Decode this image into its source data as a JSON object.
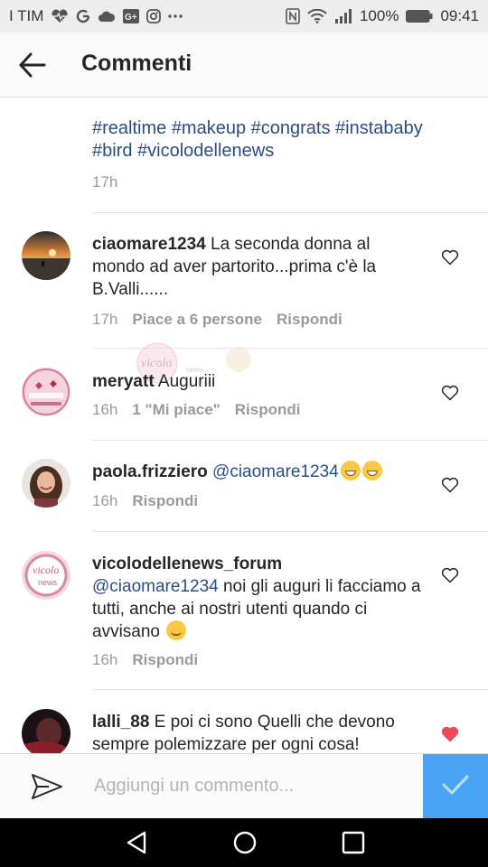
{
  "status_bar": {
    "carrier": "I TIM",
    "battery": "100%",
    "time": "09:41"
  },
  "header": {
    "title": "Commenti"
  },
  "caption": {
    "text": "#realtime #makeup #congrats #instababy #bird #vicolodellenews",
    "time": "17h"
  },
  "comments": [
    {
      "username": "ciaomare1234",
      "text": "La seconda donna al mondo ad aver partorito...prima c'è la B.Valli......",
      "time": "17h",
      "likes": "Piace a 6 persone",
      "reply": "Rispondi",
      "liked": false
    },
    {
      "username": "meryatt",
      "text": "Auguriii",
      "time": "16h",
      "likes": "1 \"Mi piace\"",
      "reply": "Rispondi",
      "liked": false
    },
    {
      "username": "paola.frizziero",
      "mention": "@ciaomare1234",
      "emoji": "grinning-face-with-smiling-eyes x2",
      "time": "16h",
      "reply": "Rispondi",
      "liked": false
    },
    {
      "username": "vicolodellenews_forum",
      "mention": "@ciaomare1234",
      "text": "noi gli auguri li facciamo a tutti, anche ai nostri utenti quando ci avvisano",
      "emoji": "winking-face",
      "time": "16h",
      "reply": "Rispondi",
      "liked": false
    },
    {
      "username": "lalli_88",
      "text": "E poi ci sono Quelli che devono sempre polemizzare per ogni cosa!",
      "liked": true
    }
  ],
  "input": {
    "placeholder": "Aggiungi un commento..."
  },
  "colors": {
    "accent": "#4aa3f4",
    "hashtag": "#2b4d86",
    "liked_heart": "#ed4956",
    "meta_gray": "#999999"
  },
  "icons": [
    "back-arrow-icon",
    "heart-icon",
    "direct-send-icon",
    "checkmark-icon",
    "nav-back-icon",
    "nav-home-icon",
    "nav-recents-icon",
    "wifi-icon",
    "signal-icon",
    "battery-icon"
  ]
}
